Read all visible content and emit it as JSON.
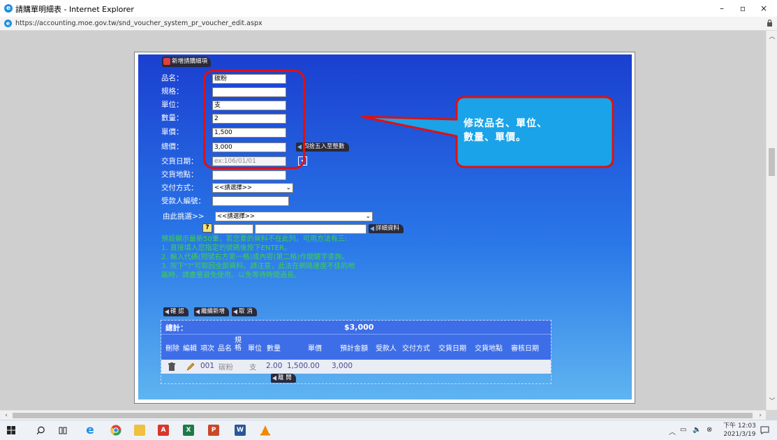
{
  "window": {
    "title": "請購單明細表 - Internet Explorer",
    "url": "https://accounting.moe.gov.tw/snd_voucher_system_pr_voucher_edit.aspx",
    "minimize": "–",
    "maximize": "▫",
    "close": "×"
  },
  "form": {
    "tab_label": "新增請購細項",
    "fields": {
      "item_name_label": "品名：",
      "item_name_value": "碳粉",
      "spec_label": "規格：",
      "spec_value": "",
      "unit_label": "單位：",
      "unit_value": "支",
      "qty_label": "數量：",
      "qty_value": "2",
      "price_label": "單價：",
      "price_value": "1,500",
      "total_label": "總價：",
      "total_value": "3,000",
      "total_button": "四捨五入至整數",
      "delivery_date_label": "交貨日期：",
      "delivery_date_placeholder": "ex:106/01/01",
      "delivery_place_label": "交貨地點：",
      "delivery_place_value": "",
      "payment_method_label": "交付方式：",
      "payment_method_value": "<<請選擇>>",
      "payee_label": "受款人編號：",
      "payee_value": ""
    },
    "picker": {
      "label": "由此挑選>>",
      "select_value": "<<請選擇>>",
      "q_button": "?",
      "detail_button": "詳細資料"
    },
    "instructions": [
      "預設顯示最新50筆，若您要的資料不在此列，可用方法有三:",
      "1. 直接填入您指定的號碼後按下ENTER。",
      "2. 輸入代碼(問號右方第一格)或內容(第二格)作關鍵字查詢。",
      "3. 按下\"?\"可取回全部資料。請注意，此法在網路速度不佳的地",
      "區時，請盡量避免使用。以免等待時間過長。"
    ],
    "buttons": {
      "confirm": "確 認",
      "continue_add": "繼續新增",
      "cancel": "取 消",
      "leave": "離 開"
    }
  },
  "summary": {
    "total_label": "總計：",
    "total_value": "$3,000",
    "headers": [
      "刪除",
      "編輯",
      "項次",
      "品名",
      "規格",
      "單位",
      "數量",
      "單價",
      "預計金額",
      "受款人",
      "交付方式",
      "交貨日期",
      "交貨地點",
      "審核日期"
    ],
    "row": {
      "index": "001",
      "item": "碳粉",
      "unit": "支",
      "qty": "2.00",
      "price": "1,500.00",
      "amount": "3,000"
    }
  },
  "annotation": {
    "line1": "修改品名、單位、",
    "line2": "數量、單價。",
    "highlight_color": "#e01010",
    "callout_color": "#1aa3e8"
  },
  "taskbar": {
    "time": "下午 12:03",
    "date": "2021/3/19",
    "apps": [
      "start-icon",
      "search-icon",
      "task-view-icon",
      "ie-icon",
      "chrome-icon",
      "file-explorer-icon",
      "acrobat-icon",
      "excel-icon",
      "powerpoint-icon",
      "word-icon",
      "vlc-icon"
    ]
  }
}
